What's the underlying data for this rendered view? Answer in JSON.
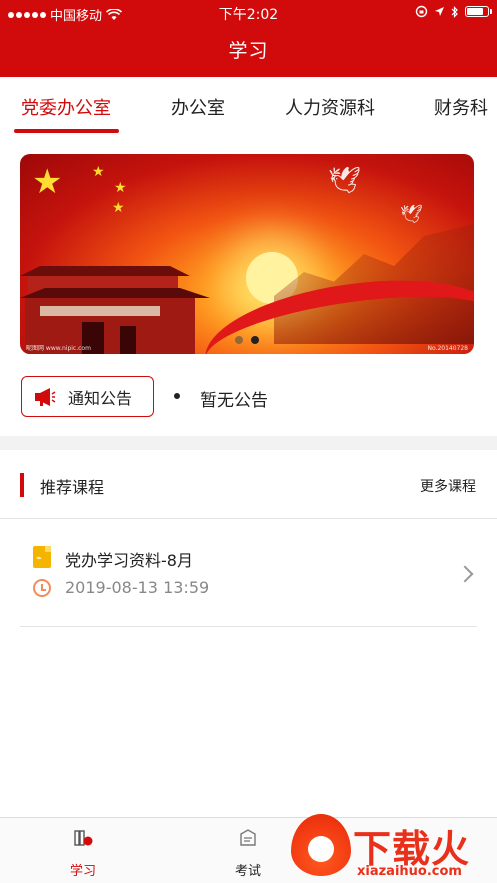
{
  "status_bar": {
    "carrier": "中国移动",
    "time": "下午2:02"
  },
  "header": {
    "title": "学习"
  },
  "tabs": [
    {
      "label": "党委办公室",
      "active": true
    },
    {
      "label": "办公室",
      "active": false
    },
    {
      "label": "人力资源科",
      "active": false
    },
    {
      "label": "财务科",
      "active": false
    }
  ],
  "banner": {
    "watermark_left": "昵图网  www.nipic.com",
    "watermark_right": "No.20140728",
    "page_count": 2,
    "current_page": 2
  },
  "notice": {
    "button_label": "通知公告",
    "text": "暂无公告"
  },
  "section": {
    "title": "推荐课程",
    "more_label": "更多课程"
  },
  "courses": [
    {
      "title": "党办学习资料-8月",
      "datetime": "2019-08-13 13:59"
    }
  ],
  "bottom_nav": [
    {
      "label": "学习",
      "icon": "book-icon",
      "active": true
    },
    {
      "label": "考试",
      "icon": "exam-icon",
      "active": false
    }
  ],
  "watermark": {
    "brand": "下载火",
    "domain": "xiazaihuo.com"
  },
  "colors": {
    "primary": "#d10b0b",
    "background": "#ffffff",
    "divider_band": "#f2f2f2"
  }
}
